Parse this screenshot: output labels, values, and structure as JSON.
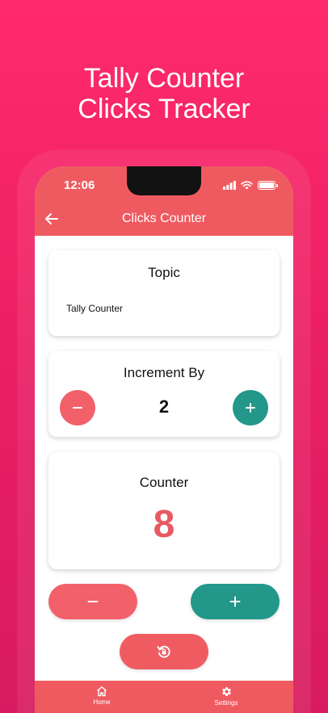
{
  "promo": {
    "line1": "Tally Counter",
    "line2": "Clicks Tracker"
  },
  "status_bar": {
    "time": "12:06",
    "icons": [
      "signal-icon",
      "wifi-icon",
      "battery-icon"
    ]
  },
  "app_bar": {
    "back_icon": "arrow-left-icon",
    "title": "Clicks Counter"
  },
  "topic": {
    "title": "Topic",
    "value": "Tally Counter"
  },
  "increment": {
    "title": "Increment By",
    "value": "2",
    "minus_icon": "minus-icon",
    "plus_icon": "plus-icon"
  },
  "counter": {
    "title": "Counter",
    "value": "8"
  },
  "actions": {
    "decrement_icon": "minus-icon",
    "increment_icon": "plus-icon",
    "reset_icon": "reset-icon"
  },
  "bottom_nav": {
    "items": [
      {
        "label": "Home",
        "icon": "home-icon"
      },
      {
        "label": "Settings",
        "icon": "gear-icon"
      }
    ]
  },
  "colors": {
    "background": "#e91e63",
    "primary": "#ef5a60",
    "teal": "#23978a",
    "counter_text": "#e75a62"
  }
}
